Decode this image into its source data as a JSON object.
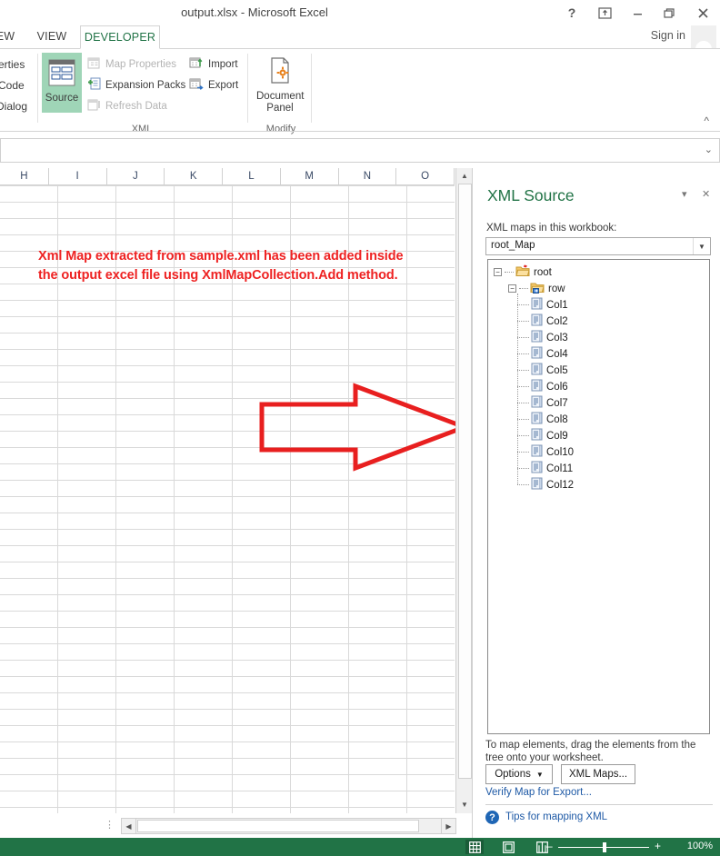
{
  "window": {
    "title": "output.xlsx - Microsoft Excel",
    "help_icon": "?",
    "ribbon_display_icon": "ribbon-display-options-icon",
    "minimize_icon": "—",
    "restore_icon": "restore-icon",
    "close_icon": "✕",
    "signin_label": "Sign in"
  },
  "tabs": [
    {
      "label": "EW",
      "active": false
    },
    {
      "label": "VIEW",
      "active": false
    },
    {
      "label": "DEVELOPER",
      "active": true
    }
  ],
  "ribbon": {
    "left_partial_labels": [
      "erties",
      "Code",
      "Dialog"
    ],
    "collapse_icon": "^",
    "groups": [
      {
        "name": "XML",
        "big_buttons": [
          {
            "label": "Source",
            "selected": true,
            "icon": "xml-source-icon"
          }
        ],
        "small_buttons": [
          {
            "label": "Map Properties",
            "disabled": true,
            "icon": "map-properties-icon"
          },
          {
            "label": "Expansion Packs",
            "disabled": false,
            "icon": "expansion-packs-icon"
          },
          {
            "label": "Refresh Data",
            "disabled": true,
            "icon": "refresh-data-icon"
          },
          {
            "label": "Import",
            "disabled": false,
            "icon": "import-icon"
          },
          {
            "label": "Export",
            "disabled": false,
            "icon": "export-icon"
          }
        ]
      },
      {
        "name": "Modify",
        "big_buttons": [
          {
            "label": "Document\nPanel",
            "line1": "Document",
            "line2": "Panel",
            "selected": false,
            "icon": "document-panel-icon"
          }
        ],
        "small_buttons": []
      }
    ]
  },
  "formula_bar": {
    "value": "",
    "expand_icon": "⌄"
  },
  "worksheet": {
    "column_headers": [
      "H",
      "I",
      "J",
      "K",
      "L",
      "M",
      "N",
      "O"
    ],
    "annotation_text": "Xml Map extracted from sample.xml has been added inside the output excel file using XmlMapCollection.Add method.",
    "annotation_color": "#ee2222",
    "arrow_shape": "right-block-arrow",
    "highlight_shape": "rounded-rectangle"
  },
  "sheet_tab_bar": {
    "scroll_left_icon": "◀",
    "scroll_right_icon": "▶",
    "separator_icon": "⋮"
  },
  "status_bar": {
    "views": [
      {
        "name": "normal-view",
        "icon": "grid-icon",
        "active": true
      },
      {
        "name": "page-layout-view",
        "icon": "page-icon",
        "active": false
      },
      {
        "name": "page-break-preview",
        "icon": "book-icon",
        "active": false
      }
    ],
    "zoom_out_icon": "–",
    "zoom_in_icon": "+",
    "zoom_level": "100%"
  },
  "xml_pane": {
    "title": "XML Source",
    "dropdown_icon": "▾",
    "close_icon": "✕",
    "maps_label": "XML maps in this workbook:",
    "selected_map": "root_Map",
    "combo_arrow_icon": "▼",
    "tree": {
      "root": {
        "label": "root",
        "icon": "folder-new-icon",
        "expander": "−"
      },
      "row": {
        "label": "row",
        "icon": "folder-mapped-icon",
        "expander": "−"
      },
      "leaves": [
        {
          "label": "Col1",
          "icon": "xml-element-icon"
        },
        {
          "label": "Col2",
          "icon": "xml-element-icon"
        },
        {
          "label": "Col3",
          "icon": "xml-element-icon"
        },
        {
          "label": "Col4",
          "icon": "xml-element-icon"
        },
        {
          "label": "Col5",
          "icon": "xml-element-icon"
        },
        {
          "label": "Col6",
          "icon": "xml-element-icon"
        },
        {
          "label": "Col7",
          "icon": "xml-element-icon"
        },
        {
          "label": "Col8",
          "icon": "xml-element-icon"
        },
        {
          "label": "Col9",
          "icon": "xml-element-icon"
        },
        {
          "label": "Col10",
          "icon": "xml-element-icon"
        },
        {
          "label": "Col11",
          "icon": "xml-element-icon"
        },
        {
          "label": "Col12",
          "icon": "xml-element-icon"
        }
      ]
    },
    "hint_text": "To map elements, drag the elements from the tree onto your worksheet.",
    "options_button": "Options",
    "options_arrow": "▼",
    "xml_maps_button": "XML Maps...",
    "verify_link": "Verify Map for Export...",
    "tips_link": "Tips for mapping XML",
    "help_icon_glyph": "?"
  }
}
